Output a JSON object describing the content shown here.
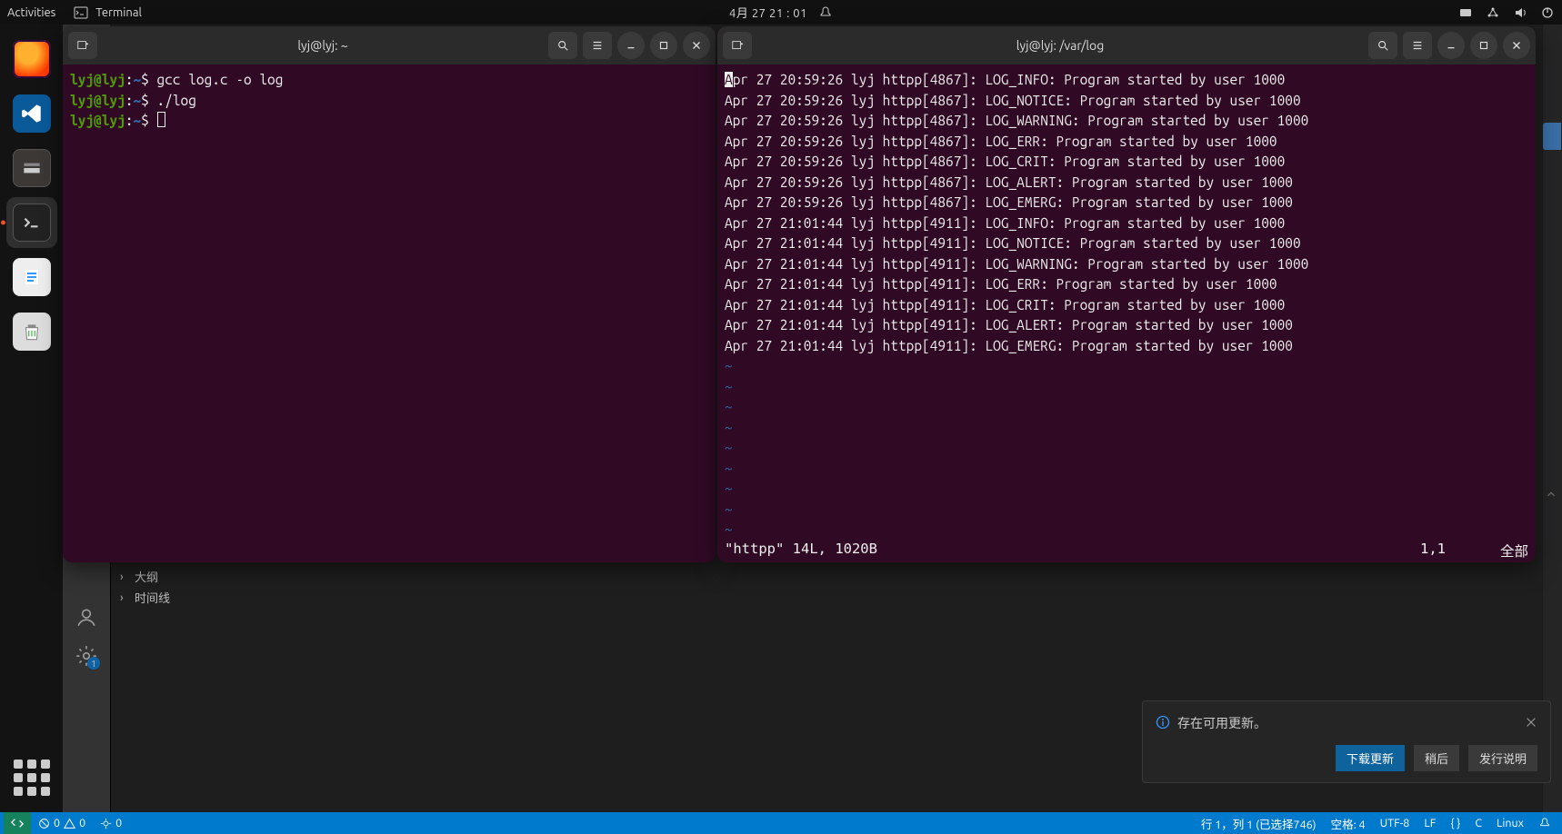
{
  "topbar": {
    "activities": "Activities",
    "app_label": "Terminal",
    "clock": "4月 27  21 : 01"
  },
  "dock": {
    "items": [
      "firefox",
      "vscode",
      "files",
      "terminal",
      "text-editor",
      "trash"
    ],
    "active": "terminal"
  },
  "terminal_left": {
    "title": "lyj@lyj: ~",
    "lines": [
      {
        "prompt": "lyj@lyj",
        "path": "~",
        "cmd": "gcc log.c -o log"
      },
      {
        "prompt": "lyj@lyj",
        "path": "~",
        "cmd": "./log"
      },
      {
        "prompt": "lyj@lyj",
        "path": "~",
        "cmd": ""
      }
    ]
  },
  "terminal_right": {
    "title": "lyj@lyj: /var/log",
    "log_lines": [
      "Apr 27 20:59:26 lyj httpp[4867]: LOG_INFO: Program started by user 1000",
      "Apr 27 20:59:26 lyj httpp[4867]: LOG_NOTICE: Program started by user 1000",
      "Apr 27 20:59:26 lyj httpp[4867]: LOG_WARNING: Program started by user 1000",
      "Apr 27 20:59:26 lyj httpp[4867]: LOG_ERR: Program started by user 1000",
      "Apr 27 20:59:26 lyj httpp[4867]: LOG_CRIT: Program started by user 1000",
      "Apr 27 20:59:26 lyj httpp[4867]: LOG_ALERT: Program started by user 1000",
      "Apr 27 20:59:26 lyj httpp[4867]: LOG_EMERG: Program started by user 1000",
      "Apr 27 21:01:44 lyj httpp[4911]: LOG_INFO: Program started by user 1000",
      "Apr 27 21:01:44 lyj httpp[4911]: LOG_NOTICE: Program started by user 1000",
      "Apr 27 21:01:44 lyj httpp[4911]: LOG_WARNING: Program started by user 1000",
      "Apr 27 21:01:44 lyj httpp[4911]: LOG_ERR: Program started by user 1000",
      "Apr 27 21:01:44 lyj httpp[4911]: LOG_CRIT: Program started by user 1000",
      "Apr 27 21:01:44 lyj httpp[4911]: LOG_ALERT: Program started by user 1000",
      "Apr 27 21:01:44 lyj httpp[4911]: LOG_EMERG: Program started by user 1000"
    ],
    "tilde_rows": 9,
    "vim_file": "\"httpp\" 14L, 1020B",
    "vim_pos": "1,1",
    "vim_scroll": "全部"
  },
  "vscode": {
    "outline_label": "大纲",
    "timeline_label": "时间线",
    "settings_badge": "1"
  },
  "statusbar": {
    "errors": "0",
    "warnings": "0",
    "ports": "0",
    "cursor": "行 1，列 1 (已选择746)",
    "spaces": "空格: 4",
    "encoding": "UTF-8",
    "eol": "LF",
    "lang_braces": "{ }",
    "lang": "C",
    "os": "Linux"
  },
  "toast": {
    "message": "存在可用更新。",
    "primary": "下载更新",
    "later": "稍后",
    "notes": "发行说明"
  }
}
